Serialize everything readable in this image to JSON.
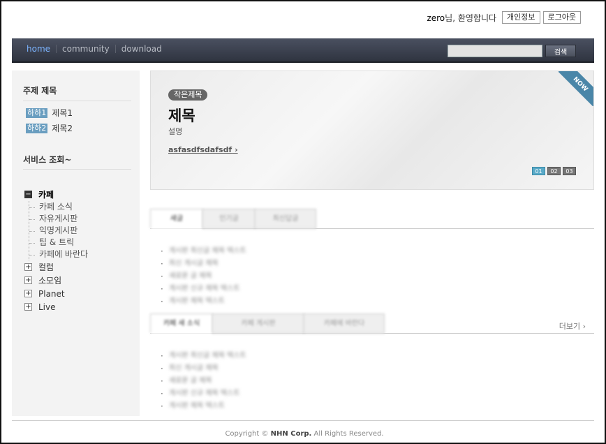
{
  "userbar": {
    "user": "zero",
    "greeting": "님, 환영합니다",
    "profile_label": "개인정보",
    "logout_label": "로그아웃"
  },
  "nav": {
    "items": [
      "home",
      "community",
      "download"
    ],
    "search_placeholder": "",
    "search_label": "검색"
  },
  "sidebar": {
    "topic_title": "주제 제목",
    "topics": [
      {
        "badge": "하하1",
        "label": "제목1"
      },
      {
        "badge": "하하2",
        "label": "제목2"
      }
    ],
    "service_title": "서비스 조회~",
    "tree": {
      "open": "카페",
      "children": [
        "카페 소식",
        "자유게시판",
        "익명게시판",
        "팁 & 트릭",
        "카페에 바란다"
      ],
      "closed": [
        "컬럼",
        "소모임",
        "Planet",
        "Live"
      ]
    }
  },
  "banner": {
    "pill": "작은제목",
    "title": "제목",
    "desc": "설명",
    "link": "asfasdfsdafsdf",
    "ribbon": "NOW",
    "pages": [
      "01",
      "02",
      "03"
    ]
  },
  "tabs1": {
    "labels": [
      "새글",
      "인기글",
      "최신답글"
    ],
    "items": [
      "게시판 최신글 제목 텍스트",
      "최신 게시글 제목",
      "새로운 글 제목",
      "게시판 신규 제목 텍스트",
      "게시판 제목 텍스트"
    ]
  },
  "tabs2": {
    "labels": [
      "카페 새 소식",
      "카페 게시판",
      "카페에 바란다"
    ],
    "more": "더보기 ›",
    "items": [
      "게시판 최신글 제목 텍스트",
      "최신 게시글 제목",
      "새로운 글 제목",
      "게시판 신규 제목 텍스트",
      "게시판 제목 텍스트"
    ]
  },
  "footer": {
    "pre": "Copyright © ",
    "company": "NHN Corp.",
    "post": " All Rights Reserved."
  },
  "colors": {
    "nav_bg": "#3a3f4b",
    "nav_active": "#7cb4ff",
    "badge": "#6a9ec0",
    "ribbon": "#4a86a8",
    "pager_active": "#5aaac8"
  }
}
